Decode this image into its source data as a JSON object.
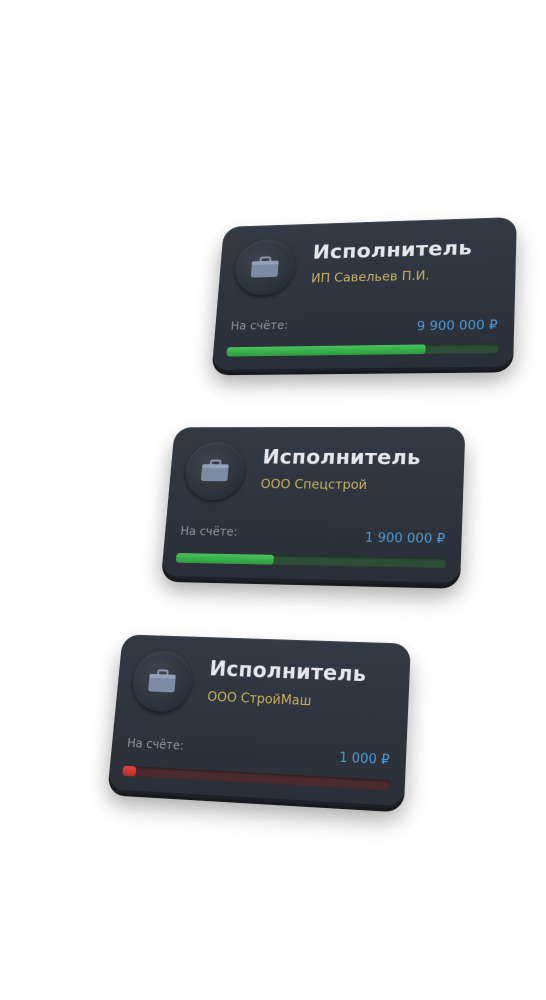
{
  "cards": [
    {
      "title": "Исполнитель",
      "company": "ИП Савельев П.И.",
      "balance_label": "На счёте:",
      "balance_value": "9 900 000 ₽",
      "progress_fraction": 0.74,
      "status": "green"
    },
    {
      "title": "Исполнитель",
      "company": "ООО Спецстрой",
      "balance_label": "На счёте:",
      "balance_value": "1 900 000 ₽",
      "progress_fraction": 0.37,
      "status": "green"
    },
    {
      "title": "Исполнитель",
      "company": "ООО СтройМаш",
      "balance_label": "На счёте:",
      "balance_value": "1 000 ₽",
      "progress_fraction": 0.05,
      "status": "red"
    }
  ],
  "icons": {
    "avatar": "briefcase-icon"
  },
  "colors": {
    "card_background": "#2f343c",
    "title": "#e4e6ea",
    "company": "#c7b061",
    "balance_label": "#8b93a0",
    "balance_value": "#4a9bd6",
    "progress_green": "#3fb552",
    "progress_green_track": "#2e4c37",
    "progress_red": "#d63a37",
    "progress_red_track": "#4a2a2e",
    "briefcase": "#7c8aa3"
  }
}
